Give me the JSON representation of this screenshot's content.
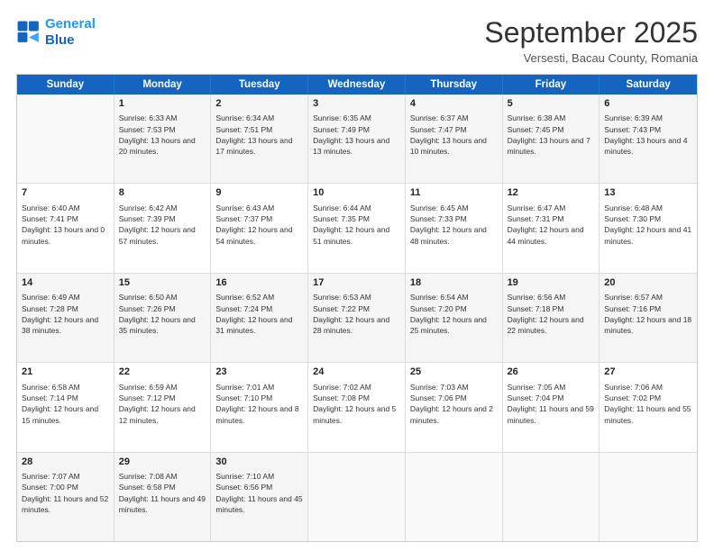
{
  "logo": {
    "line1": "General",
    "line2": "Blue"
  },
  "title": "September 2025",
  "subtitle": "Versesti, Bacau County, Romania",
  "weekdays": [
    "Sunday",
    "Monday",
    "Tuesday",
    "Wednesday",
    "Thursday",
    "Friday",
    "Saturday"
  ],
  "rows": [
    [
      {
        "day": "",
        "empty": true
      },
      {
        "day": "1",
        "sunrise": "Sunrise: 6:33 AM",
        "sunset": "Sunset: 7:53 PM",
        "daylight": "Daylight: 13 hours and 20 minutes."
      },
      {
        "day": "2",
        "sunrise": "Sunrise: 6:34 AM",
        "sunset": "Sunset: 7:51 PM",
        "daylight": "Daylight: 13 hours and 17 minutes."
      },
      {
        "day": "3",
        "sunrise": "Sunrise: 6:35 AM",
        "sunset": "Sunset: 7:49 PM",
        "daylight": "Daylight: 13 hours and 13 minutes."
      },
      {
        "day": "4",
        "sunrise": "Sunrise: 6:37 AM",
        "sunset": "Sunset: 7:47 PM",
        "daylight": "Daylight: 13 hours and 10 minutes."
      },
      {
        "day": "5",
        "sunrise": "Sunrise: 6:38 AM",
        "sunset": "Sunset: 7:45 PM",
        "daylight": "Daylight: 13 hours and 7 minutes."
      },
      {
        "day": "6",
        "sunrise": "Sunrise: 6:39 AM",
        "sunset": "Sunset: 7:43 PM",
        "daylight": "Daylight: 13 hours and 4 minutes."
      }
    ],
    [
      {
        "day": "7",
        "sunrise": "Sunrise: 6:40 AM",
        "sunset": "Sunset: 7:41 PM",
        "daylight": "Daylight: 13 hours and 0 minutes."
      },
      {
        "day": "8",
        "sunrise": "Sunrise: 6:42 AM",
        "sunset": "Sunset: 7:39 PM",
        "daylight": "Daylight: 12 hours and 57 minutes."
      },
      {
        "day": "9",
        "sunrise": "Sunrise: 6:43 AM",
        "sunset": "Sunset: 7:37 PM",
        "daylight": "Daylight: 12 hours and 54 minutes."
      },
      {
        "day": "10",
        "sunrise": "Sunrise: 6:44 AM",
        "sunset": "Sunset: 7:35 PM",
        "daylight": "Daylight: 12 hours and 51 minutes."
      },
      {
        "day": "11",
        "sunrise": "Sunrise: 6:45 AM",
        "sunset": "Sunset: 7:33 PM",
        "daylight": "Daylight: 12 hours and 48 minutes."
      },
      {
        "day": "12",
        "sunrise": "Sunrise: 6:47 AM",
        "sunset": "Sunset: 7:31 PM",
        "daylight": "Daylight: 12 hours and 44 minutes."
      },
      {
        "day": "13",
        "sunrise": "Sunrise: 6:48 AM",
        "sunset": "Sunset: 7:30 PM",
        "daylight": "Daylight: 12 hours and 41 minutes."
      }
    ],
    [
      {
        "day": "14",
        "sunrise": "Sunrise: 6:49 AM",
        "sunset": "Sunset: 7:28 PM",
        "daylight": "Daylight: 12 hours and 38 minutes."
      },
      {
        "day": "15",
        "sunrise": "Sunrise: 6:50 AM",
        "sunset": "Sunset: 7:26 PM",
        "daylight": "Daylight: 12 hours and 35 minutes."
      },
      {
        "day": "16",
        "sunrise": "Sunrise: 6:52 AM",
        "sunset": "Sunset: 7:24 PM",
        "daylight": "Daylight: 12 hours and 31 minutes."
      },
      {
        "day": "17",
        "sunrise": "Sunrise: 6:53 AM",
        "sunset": "Sunset: 7:22 PM",
        "daylight": "Daylight: 12 hours and 28 minutes."
      },
      {
        "day": "18",
        "sunrise": "Sunrise: 6:54 AM",
        "sunset": "Sunset: 7:20 PM",
        "daylight": "Daylight: 12 hours and 25 minutes."
      },
      {
        "day": "19",
        "sunrise": "Sunrise: 6:56 AM",
        "sunset": "Sunset: 7:18 PM",
        "daylight": "Daylight: 12 hours and 22 minutes."
      },
      {
        "day": "20",
        "sunrise": "Sunrise: 6:57 AM",
        "sunset": "Sunset: 7:16 PM",
        "daylight": "Daylight: 12 hours and 18 minutes."
      }
    ],
    [
      {
        "day": "21",
        "sunrise": "Sunrise: 6:58 AM",
        "sunset": "Sunset: 7:14 PM",
        "daylight": "Daylight: 12 hours and 15 minutes."
      },
      {
        "day": "22",
        "sunrise": "Sunrise: 6:59 AM",
        "sunset": "Sunset: 7:12 PM",
        "daylight": "Daylight: 12 hours and 12 minutes."
      },
      {
        "day": "23",
        "sunrise": "Sunrise: 7:01 AM",
        "sunset": "Sunset: 7:10 PM",
        "daylight": "Daylight: 12 hours and 8 minutes."
      },
      {
        "day": "24",
        "sunrise": "Sunrise: 7:02 AM",
        "sunset": "Sunset: 7:08 PM",
        "daylight": "Daylight: 12 hours and 5 minutes."
      },
      {
        "day": "25",
        "sunrise": "Sunrise: 7:03 AM",
        "sunset": "Sunset: 7:06 PM",
        "daylight": "Daylight: 12 hours and 2 minutes."
      },
      {
        "day": "26",
        "sunrise": "Sunrise: 7:05 AM",
        "sunset": "Sunset: 7:04 PM",
        "daylight": "Daylight: 11 hours and 59 minutes."
      },
      {
        "day": "27",
        "sunrise": "Sunrise: 7:06 AM",
        "sunset": "Sunset: 7:02 PM",
        "daylight": "Daylight: 11 hours and 55 minutes."
      }
    ],
    [
      {
        "day": "28",
        "sunrise": "Sunrise: 7:07 AM",
        "sunset": "Sunset: 7:00 PM",
        "daylight": "Daylight: 11 hours and 52 minutes."
      },
      {
        "day": "29",
        "sunrise": "Sunrise: 7:08 AM",
        "sunset": "Sunset: 6:58 PM",
        "daylight": "Daylight: 11 hours and 49 minutes."
      },
      {
        "day": "30",
        "sunrise": "Sunrise: 7:10 AM",
        "sunset": "Sunset: 6:56 PM",
        "daylight": "Daylight: 11 hours and 45 minutes."
      },
      {
        "day": "",
        "empty": true
      },
      {
        "day": "",
        "empty": true
      },
      {
        "day": "",
        "empty": true
      },
      {
        "day": "",
        "empty": true
      }
    ]
  ]
}
